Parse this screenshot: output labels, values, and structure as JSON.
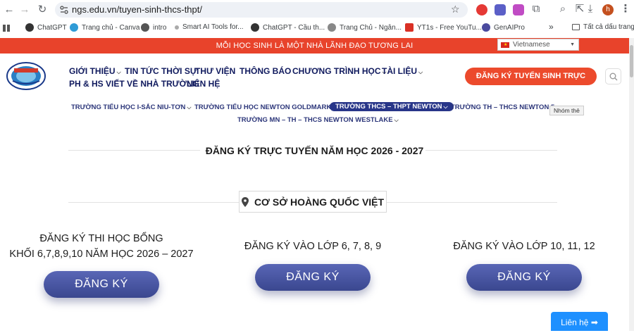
{
  "browser": {
    "url": "ngs.edu.vn/tuyen-sinh-thcs-thpt/",
    "profile_initial": "h"
  },
  "bookmarks": {
    "items": [
      {
        "label": "ChatGPT",
        "color": "#333333"
      },
      {
        "label": "Trang chủ - Canva",
        "color": "#2f9bd6"
      },
      {
        "label": "intro",
        "color": "#555555"
      },
      {
        "label": "Smart AI Tools for...",
        "color": "#999999"
      },
      {
        "label": "ChatGPT - Cầu th...",
        "color": "#333333"
      },
      {
        "label": "Trang Chủ - Ngân...",
        "color": "#888888"
      },
      {
        "label": "YT1s - Free YouTu...",
        "color": "#d93025"
      },
      {
        "label": "GenAIPro",
        "color": "#4a4a9e"
      }
    ],
    "more": "»",
    "all_bookmarks": "Tất cả dấu trang"
  },
  "site": {
    "banner": "MỖI HỌC SINH LÀ MỘT NHÀ LÃNH ĐẠO TƯƠNG LAI",
    "language": "Vietnamese",
    "menu": [
      {
        "label": "GIỚI THIỆU",
        "has_caret": true
      },
      {
        "label": "TIN TỨC THỜI SỰ",
        "has_caret": false
      },
      {
        "label": "THƯ VIỆN",
        "has_caret": false
      },
      {
        "label": "THÔNG BÁO",
        "has_caret": false
      },
      {
        "label": "CHƯƠNG TRÌNH HỌC",
        "has_caret": true
      },
      {
        "label": "TÀI LIỆU",
        "has_caret": true
      },
      {
        "label": "PH & HS VIẾT VỀ NHÀ TRƯỜNG",
        "has_caret": false
      },
      {
        "label": "LIÊN HỆ",
        "has_caret": false
      }
    ],
    "cta": "ĐĂNG KÝ TUYỂN SINH TRỰC TUYẾN",
    "subnav": [
      "TRƯỜNG TIỂU HỌC I-SẮC NIU-TƠN",
      "TRƯỜNG TIỂU HỌC NEWTON GOLDMARK",
      "TRƯỜNG THCS – THPT NEWTON",
      "TRƯỜNG TH – THCS NEWTON 5",
      "TRƯỜNG MN – TH – THCS NEWTON WESTLAKE"
    ],
    "tooltip": "Nhóm thẻ"
  },
  "main": {
    "title": "ĐĂNG KÝ TRỰC TUYẾN NĂM HỌC 2026 - 2027",
    "campus": "CƠ SỞ HOÀNG QUỐC VIỆT",
    "columns": [
      {
        "line1": "ĐĂNG KÝ THI HỌC BỔNG",
        "line2": "KHỐI 6,7,8,9,10 NĂM HỌC 2026 – 2027",
        "button": "ĐĂNG KÝ"
      },
      {
        "line1": "ĐĂNG KÝ VÀO LỚP 6, 7, 8, 9",
        "line2": "",
        "button": "ĐĂNG KÝ"
      },
      {
        "line1": "ĐĂNG KÝ VÀO LỚP 10, 11, 12",
        "line2": "",
        "button": "ĐĂNG KÝ"
      }
    ],
    "contact": "Liên hệ ➡"
  }
}
